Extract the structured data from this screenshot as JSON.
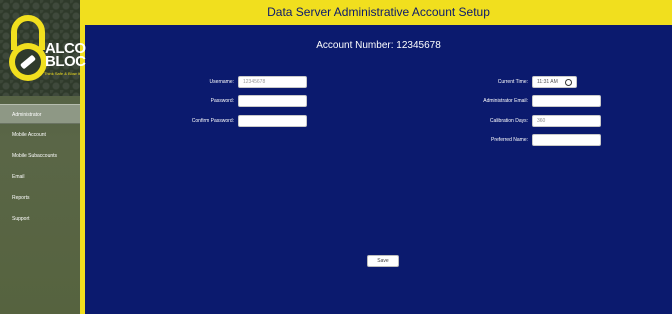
{
  "brand": {
    "line1": "ALCO",
    "line2": "BLOC",
    "tagline": "Think Safe & Blow It"
  },
  "nav": {
    "items": [
      {
        "label": "Administrator",
        "active": true
      },
      {
        "label": "Mobile Account",
        "active": false
      },
      {
        "label": "Mobile Subaccounts",
        "active": false
      },
      {
        "label": "Email",
        "active": false
      },
      {
        "label": "Reports",
        "active": false
      },
      {
        "label": "Support",
        "active": false
      }
    ]
  },
  "header": {
    "title": "Data Server Administrative Account Setup"
  },
  "account": {
    "label": "Account Number: 12345678"
  },
  "form": {
    "username_label": "Username:",
    "username_value": "12345678",
    "password_label": "Password:",
    "password_value": "",
    "confirm_password_label": "Confirm Password:",
    "confirm_password_value": "",
    "current_time_label": "Current Time:",
    "current_time_value": "11:31 AM",
    "admin_email_label": "Administrator Email:",
    "admin_email_value": "",
    "calibration_days_label": "Calibration Days:",
    "calibration_days_value": "360",
    "preferred_name_label": "Preferred Name:",
    "preferred_name_value": ""
  },
  "actions": {
    "save_label": "Save"
  },
  "colors": {
    "accent": "#f1df1e",
    "background": "#0b1a6e",
    "sidebar": "#56633f"
  },
  "icons": {
    "logo": "padlock-icon",
    "time": "clock-icon"
  }
}
